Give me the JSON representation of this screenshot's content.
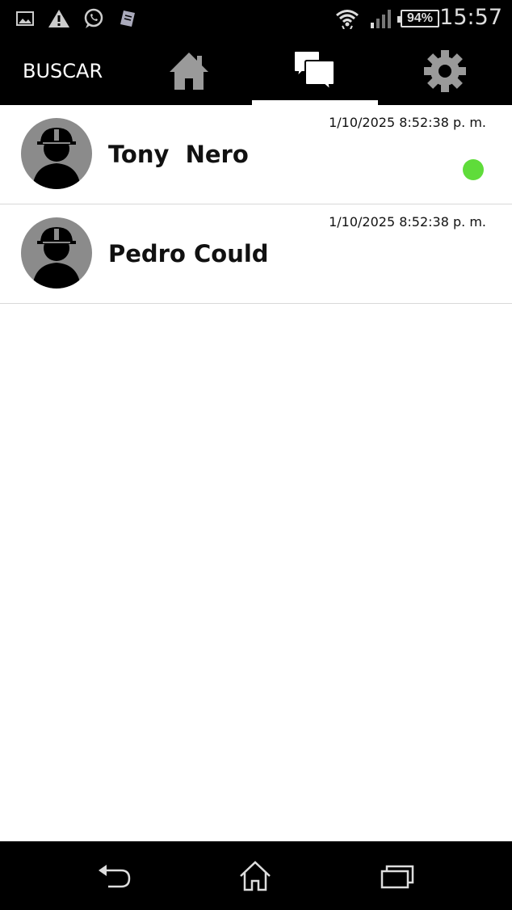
{
  "status_bar": {
    "time": "15:57",
    "battery": "94%",
    "icons": [
      "image-notification-icon",
      "warning-icon",
      "whatsapp-icon",
      "app-notification-icon",
      "wifi-icon",
      "signal-icon",
      "battery-icon"
    ]
  },
  "tabs": {
    "search_label": "BUSCAR",
    "items": [
      "home-icon",
      "chat-icon",
      "settings-icon"
    ],
    "active": "chat"
  },
  "chats": [
    {
      "name": "Tony  Nero",
      "timestamp": "1/10/2025 8:52:38 p. m.",
      "online": true
    },
    {
      "name": "Pedro Could",
      "timestamp": "1/10/2025 8:52:38 p. m.",
      "online": false
    }
  ],
  "colors": {
    "online": "#5fdc3a",
    "avatar_bg": "#8b8b8b",
    "bar_bg": "#000000"
  },
  "nav": {
    "icons": [
      "back-icon",
      "home-icon",
      "recents-icon"
    ]
  }
}
